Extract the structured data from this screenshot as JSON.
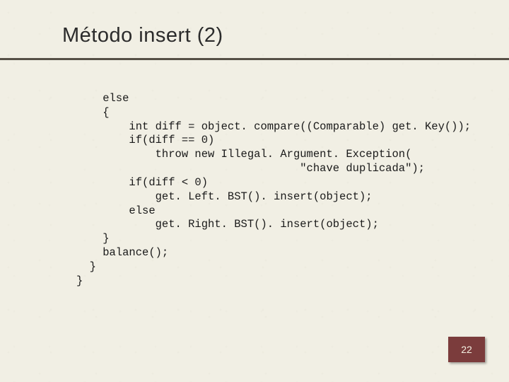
{
  "slide": {
    "title": "Método insert (2)",
    "page_number": "22"
  },
  "code": {
    "l1": "    else",
    "l2": "    {",
    "l3": "        int diff = object. compare((Comparable) get. Key());",
    "l4": "        if(diff == 0)",
    "l5": "            throw new Illegal. Argument. Exception(",
    "l6": "                                  \"chave duplicada\");",
    "l7": "        if(diff < 0)",
    "l8": "            get. Left. BST(). insert(object);",
    "l9": "        else",
    "l10": "            get. Right. BST(). insert(object);",
    "l11": "    }",
    "l12": "    balance();",
    "l13": "  }",
    "l14": "}"
  }
}
